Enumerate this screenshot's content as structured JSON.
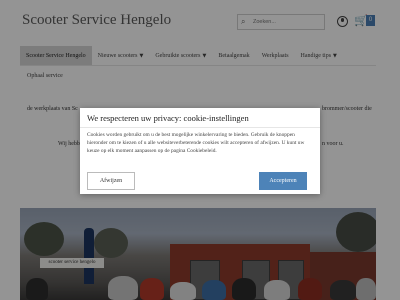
{
  "header": {
    "title": "Scooter Service Hengelo",
    "search_placeholder": "Zoeken...",
    "cart_count": "0"
  },
  "nav": {
    "items": [
      {
        "label": "Scooter Service Hengelo",
        "dropdown": false
      },
      {
        "label": "Nieuwe scooters",
        "dropdown": true
      },
      {
        "label": "Gebruikte scooters",
        "dropdown": true
      },
      {
        "label": "Betaalgemak",
        "dropdown": false
      },
      {
        "label": "Werkplaats",
        "dropdown": false
      },
      {
        "label": "Handige tips",
        "dropdown": true
      }
    ],
    "row2_label": "Ophaal service"
  },
  "background_text": {
    "line1_left": "de werkplaats van Sc",
    "line1_right": "brommer/scooter die",
    "line2_left": "Wij hebb",
    "line2_right": "n voor u."
  },
  "hero": {
    "sign_text": "scooter service hengelo"
  },
  "cookie_dialog": {
    "title": "We respecteren uw privacy: cookie-instellingen",
    "body": "Cookies worden gebruikt om u de best mogelijke winkelervaring te bieden. Gebruik de knoppen hieronder om te kiezen of u alle websiteverbeterende cookies wilt accepteren of afwijzen. U kunt uw keuze op elk moment aanpassen op de pagina Cookiebeleid.",
    "decline_label": "Afwijzen",
    "accept_label": "Accepteren"
  },
  "colors": {
    "accent": "#4d83b8",
    "nav_active_bg": "#d6d6d6",
    "overlay": "rgba(0,0,0,0.42)"
  }
}
